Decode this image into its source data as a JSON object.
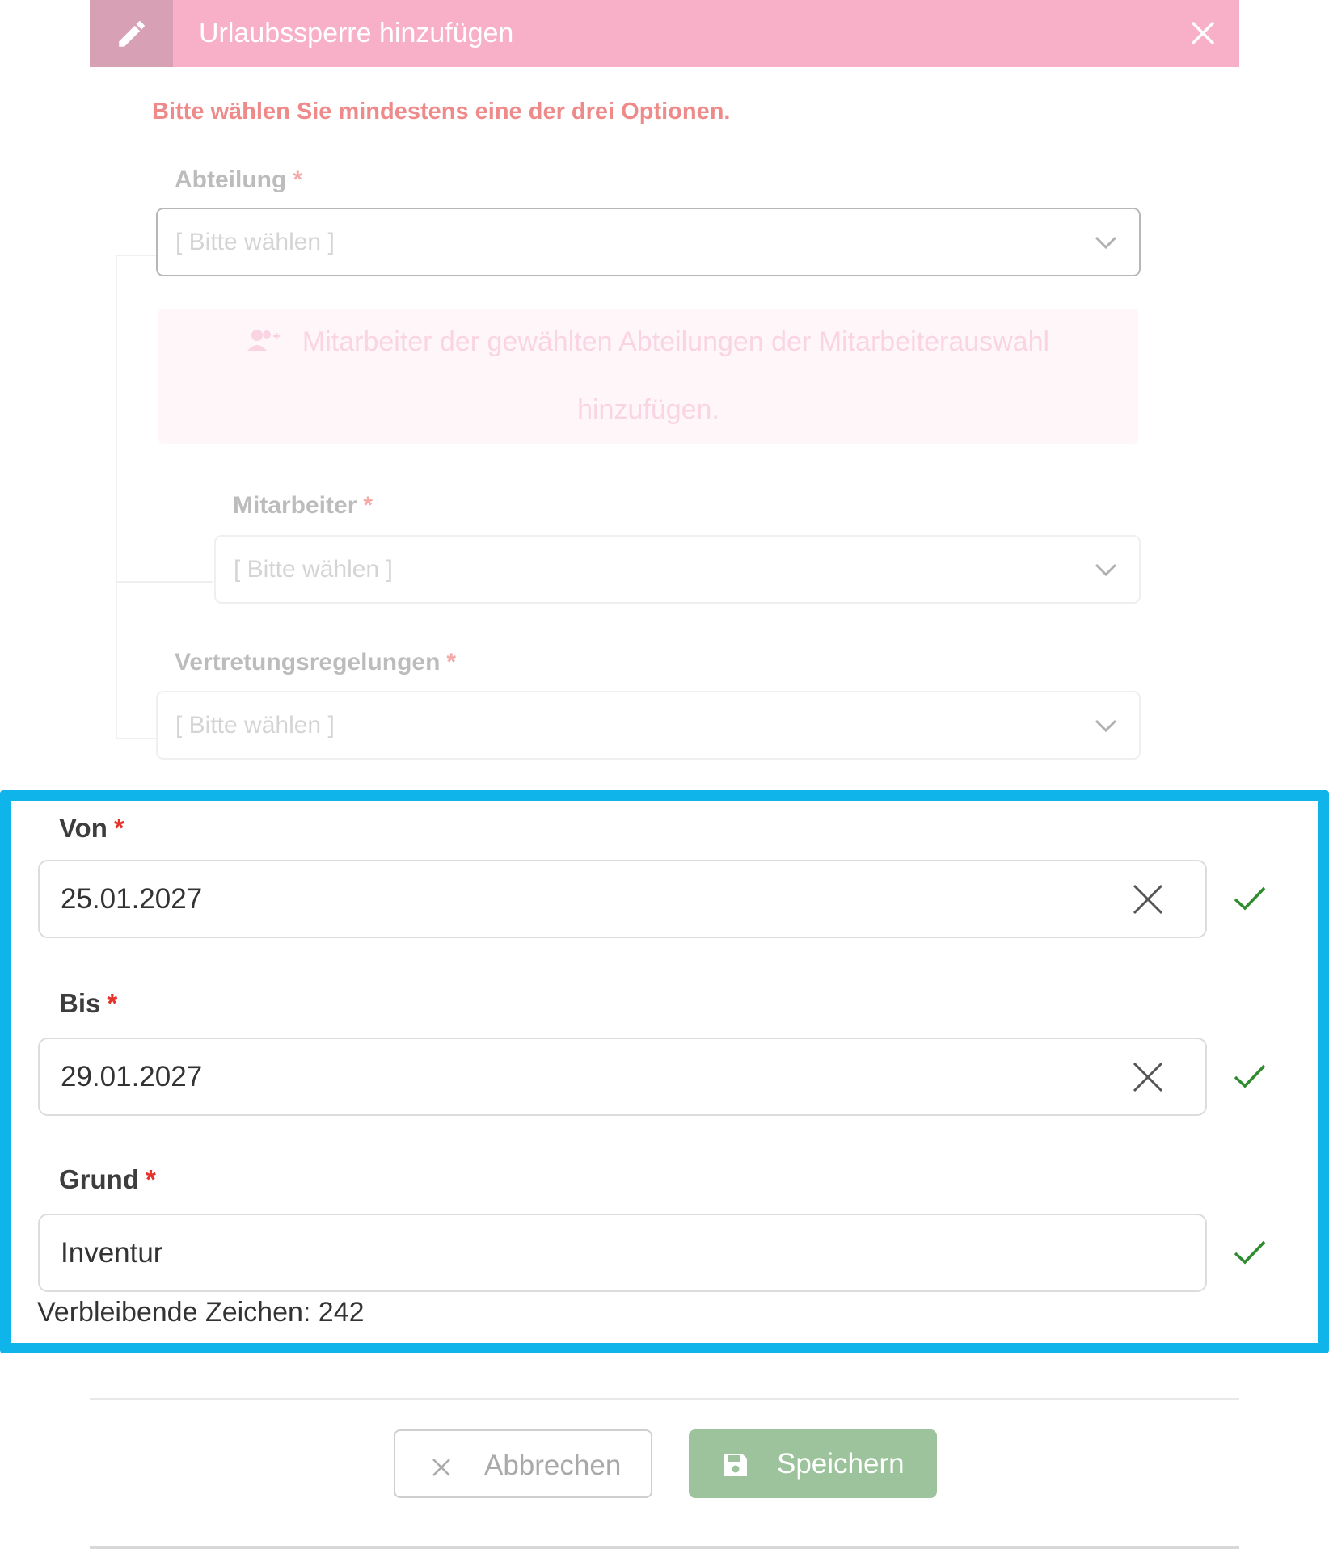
{
  "dialog": {
    "title": "Urlaubssperre hinzufügen",
    "edit_icon": "pencil-icon",
    "close_icon": "close-icon"
  },
  "error_message": "Bitte wählen Sie mindestens eine der drei Optionen.",
  "fields": {
    "abteilung": {
      "label": "Abteilung",
      "required": "*",
      "placeholder": "[ Bitte wählen ]"
    },
    "info": {
      "icon": "user-add-icon",
      "text_line1": "Mitarbeiter der gewählten Abteilungen der Mitarbeiterauswahl",
      "text_line2": "hinzufügen."
    },
    "mitarbeiter": {
      "label": "Mitarbeiter",
      "required": "*",
      "placeholder": "[ Bitte wählen ]"
    },
    "vertretung": {
      "label": "Vertretungsregelungen",
      "required": "*",
      "placeholder": "[ Bitte wählen ]"
    },
    "von": {
      "label": "Von",
      "required": "*",
      "value": "25.01.2027"
    },
    "bis": {
      "label": "Bis",
      "required": "*",
      "value": "29.01.2027"
    },
    "grund": {
      "label": "Grund",
      "required": "*",
      "value": "Inventur"
    }
  },
  "counter_text": "Verbleibende Zeichen: 242",
  "buttons": {
    "cancel": "Abbrechen",
    "save": "Speichern"
  },
  "colors": {
    "header": "#f7b0c8",
    "highlight": "#0fb4ea",
    "save_button": "#9cc39c",
    "required": "#e5322b",
    "valid_check": "#2e8b2e"
  }
}
